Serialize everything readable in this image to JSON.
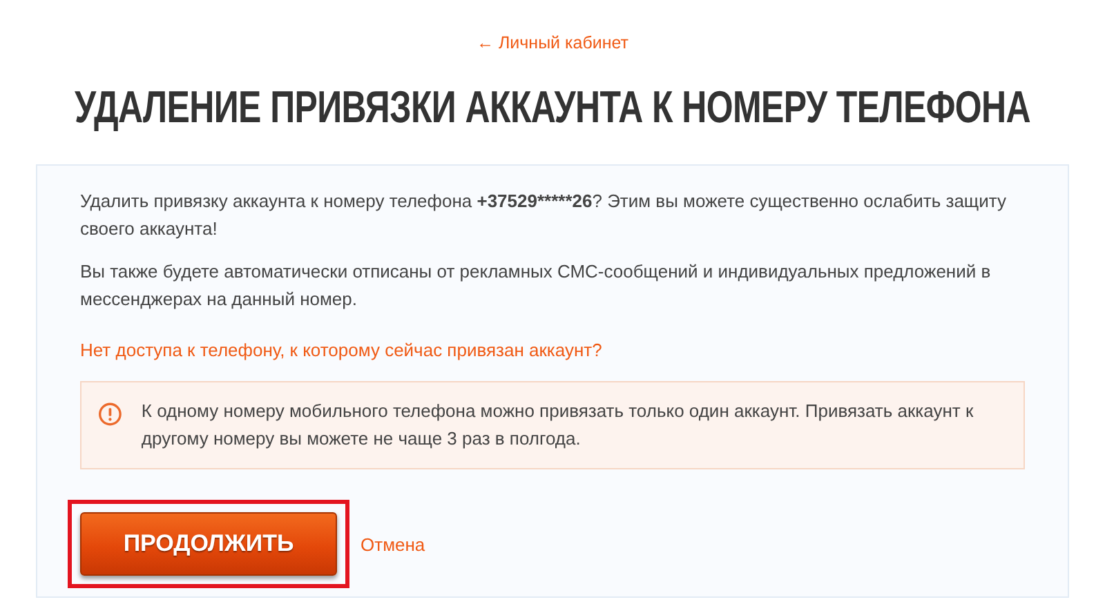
{
  "back_link": {
    "arrow": "←",
    "label": "Личный кабинет"
  },
  "title": "УДАЛЕНИЕ ПРИВЯЗКИ АККАУНТА К НОМЕРУ ТЕЛЕФОНА",
  "paragraphs": [
    {
      "before": "Удалить привязку аккаунта к номеру телефона ",
      "phone": "+37529*****26",
      "after": "? Этим вы можете существенно ослабить защиту своего аккаунта!"
    },
    {
      "before": "Вы также будете автоматически отписаны от рекламных СМС-сообщений и индивидуальных предложений в мессенджерах на данный номер."
    }
  ],
  "help_link": "Нет доступа к телефону, к которому сейчас привязан аккаунт?",
  "notice": {
    "text": "К одному номеру мобильного телефона можно привязать только один аккаунт. Привязать аккаунт к другому номеру вы можете не чаще 3 раз в полгода."
  },
  "continue_button": {
    "label": "ПРОДОЛЖИТЬ",
    "highlighted": true
  },
  "cancel_link": "Отмена"
}
